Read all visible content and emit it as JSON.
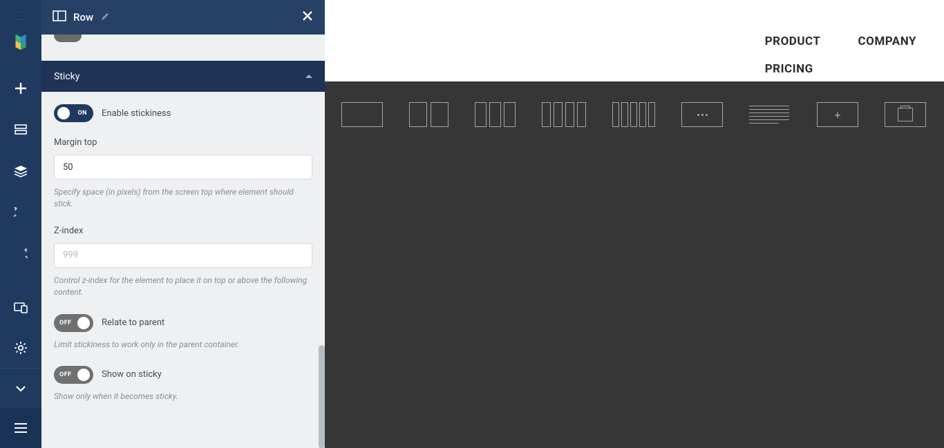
{
  "panel": {
    "title": "Row",
    "section_title": "Sticky",
    "toggle_on": "ON",
    "toggle_off": "OFF",
    "enable_label": "Enable stickiness",
    "margin_top_label": "Margin top",
    "margin_top_value": "50",
    "margin_top_hint": "Specify space (in pixels) from the screen top where element should stick.",
    "zindex_label": "Z-index",
    "zindex_placeholder": "999",
    "zindex_hint": "Control z-index for the element to place it on top or above the following content.",
    "relate_parent_label": "Relate to parent",
    "relate_parent_hint": "Limit stickiness to work only in the parent container.",
    "show_on_sticky_label": "Show on sticky",
    "show_on_sticky_hint": "Show only when it becomes sticky."
  },
  "nav": {
    "product": "PRODUCT",
    "company": "COMPANY",
    "pricing": "PRICING"
  },
  "plus_glyph": "+"
}
